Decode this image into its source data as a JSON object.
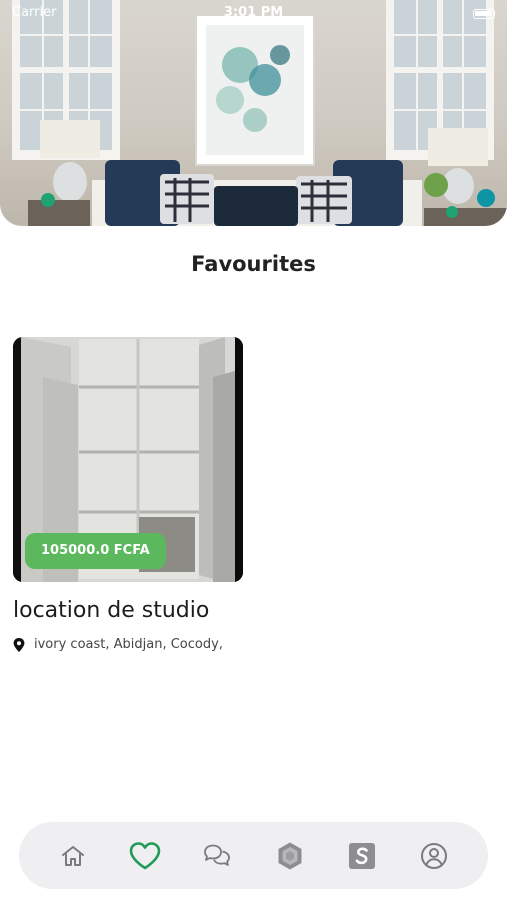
{
  "status_bar": {
    "carrier": "Carrier",
    "time": "3:01 PM"
  },
  "page": {
    "title": "Favourites"
  },
  "favourites": [
    {
      "price": "105000.0 FCFA",
      "title": "location de studio",
      "location": "ivory coast, Abidjan, Cocody,"
    }
  ],
  "bottom_nav": {
    "items": [
      {
        "icon": "home-icon",
        "active": false
      },
      {
        "icon": "heart-icon",
        "active": true
      },
      {
        "icon": "chat-icon",
        "active": false
      },
      {
        "icon": "hexagon-icon",
        "active": false
      },
      {
        "icon": "s-app-icon",
        "active": false
      },
      {
        "icon": "user-profile-icon",
        "active": false
      }
    ]
  },
  "colors": {
    "accent_green": "#5cb85c",
    "active_icon": "#1e9b57",
    "inactive_icon": "#7b7b7f",
    "nav_background": "#efeff1"
  }
}
